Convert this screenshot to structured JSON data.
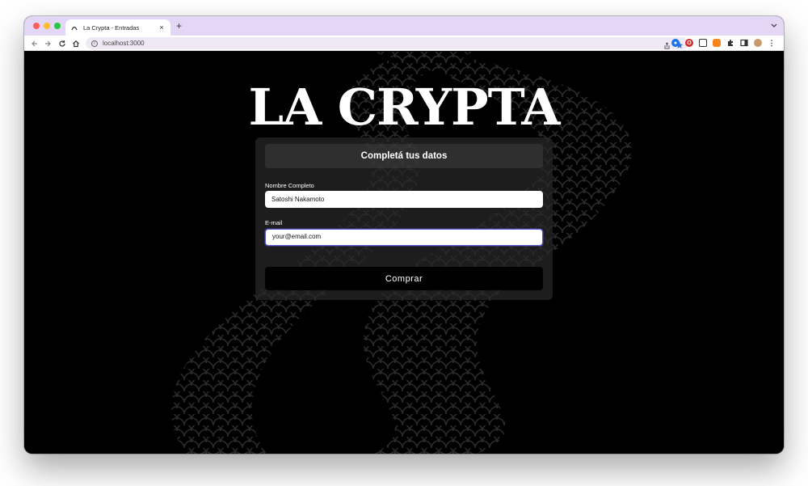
{
  "browser": {
    "tab_title": "La Crypta - Entradas",
    "close_glyph": "×",
    "new_tab_glyph": "+",
    "url": "localhost:3000",
    "accent_color": "#e4d7f6"
  },
  "page": {
    "logo_text": "LA CRYPTA",
    "form": {
      "title": "Completá tus datos",
      "name_label": "Nombre Completo",
      "name_value": "Satoshi Nakamoto",
      "email_label": "E-mail",
      "email_value": "your@email.com",
      "submit_label": "Comprar"
    }
  }
}
